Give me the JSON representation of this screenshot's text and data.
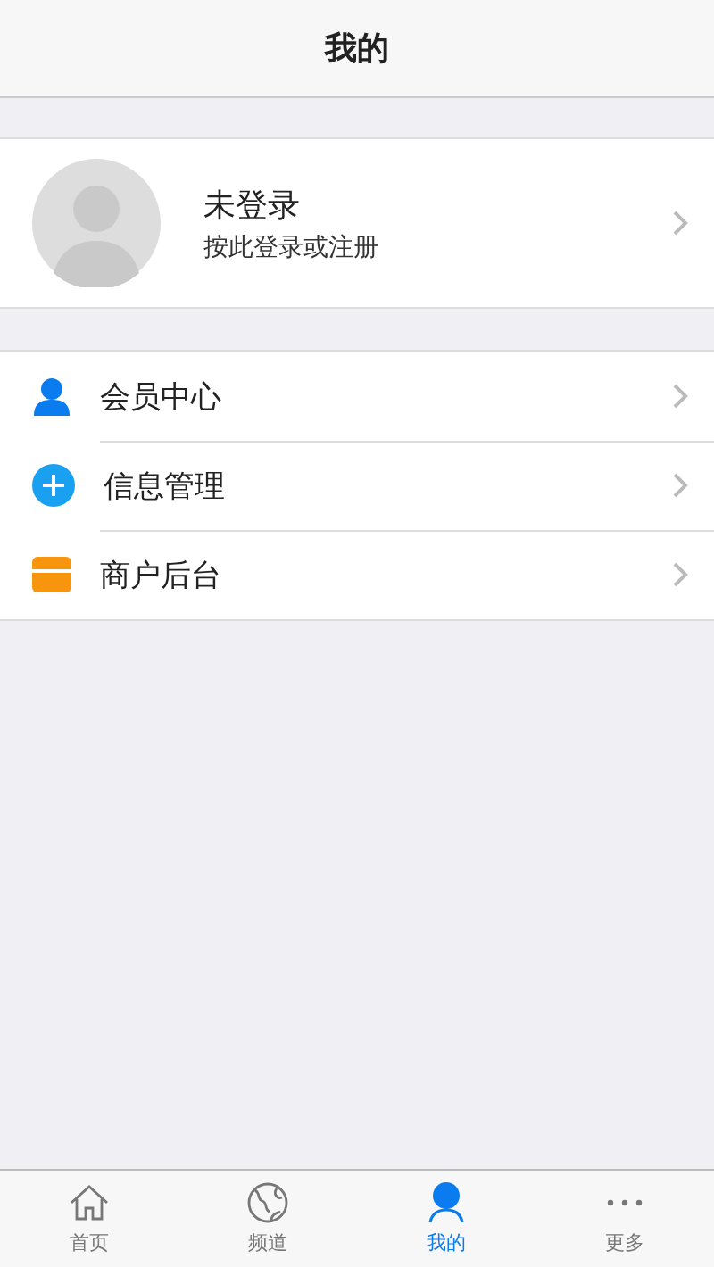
{
  "header": {
    "title": "我的"
  },
  "profile": {
    "name": "未登录",
    "hint": "按此登录或注册"
  },
  "menu": [
    {
      "kind": "member",
      "label": "会员中心"
    },
    {
      "kind": "info",
      "label": "信息管理"
    },
    {
      "kind": "merchant",
      "label": "商户后台"
    }
  ],
  "tabs": [
    {
      "kind": "home",
      "label": "首页",
      "selected": false
    },
    {
      "kind": "channel",
      "label": "频道",
      "selected": false
    },
    {
      "kind": "me",
      "label": "我的",
      "selected": true
    },
    {
      "kind": "more",
      "label": "更多",
      "selected": false
    }
  ]
}
